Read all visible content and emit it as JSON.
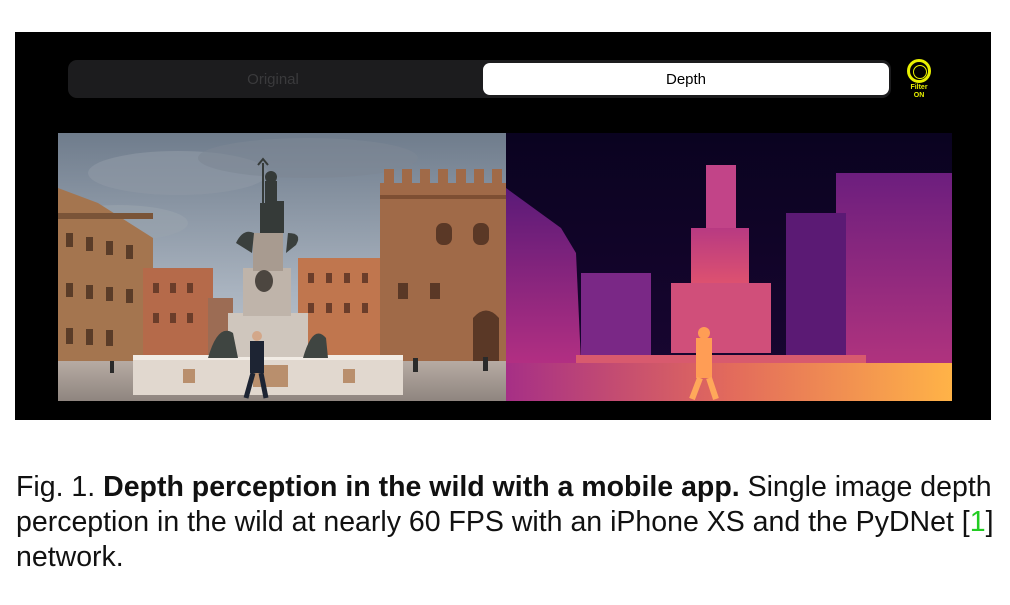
{
  "app": {
    "segments": {
      "original_label": "Original",
      "depth_label": "Depth"
    },
    "filter": {
      "line1": "Filter",
      "line2": "ON",
      "color": "#e8f000"
    }
  },
  "figure": {
    "caption": {
      "prefix": "Fig. 1.",
      "title": "Depth perception in the wild with a mobile app.",
      "body_before_cite": "Single image depth perception in the wild at nearly 60 FPS with an iPhone XS and the PyDNet [",
      "cite": "1",
      "body_after_cite": "] network."
    }
  },
  "colors": {
    "citation": "#22cc22",
    "depth_near": "#ffb347",
    "depth_mid": "#c0307a",
    "depth_far": "#1a0633"
  }
}
